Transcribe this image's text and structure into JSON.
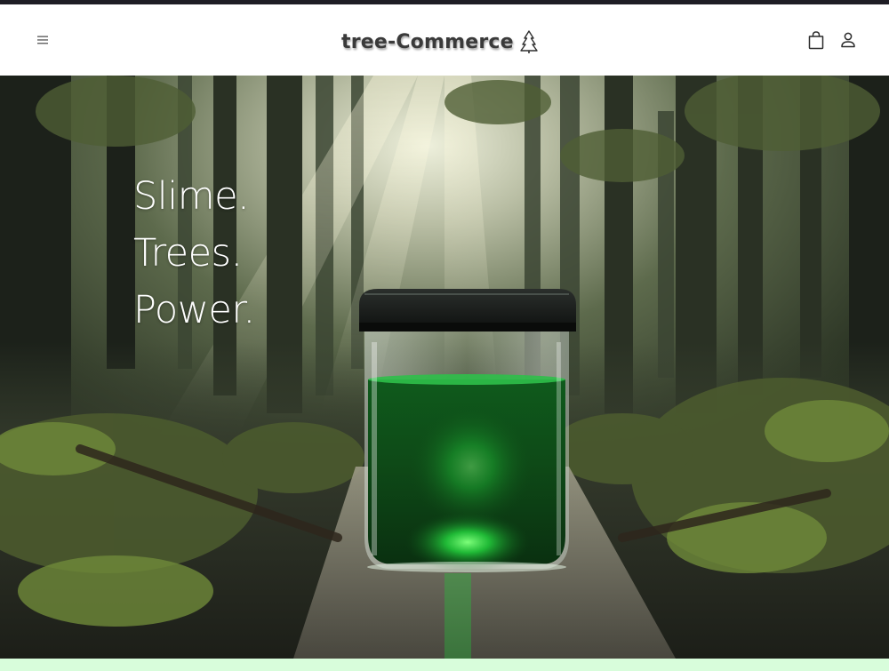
{
  "header": {
    "brand": "tree-Commerce",
    "menu_icon": "hamburger-menu-icon",
    "brand_icon": "tree-icon",
    "cart_icon": "shopping-bag-icon",
    "account_icon": "user-icon"
  },
  "hero": {
    "lines": [
      "Slime.",
      "Trees.",
      "Power."
    ],
    "image": "forest-slime-jar-image"
  },
  "colors": {
    "topbar": "#1e1d25",
    "header_bg": "#ffffff",
    "brand_text": "#3a3a3a",
    "hero_text": "#ffffff",
    "slime_green": "#1fbf3a",
    "bottom_strip": "#d8fddb"
  }
}
